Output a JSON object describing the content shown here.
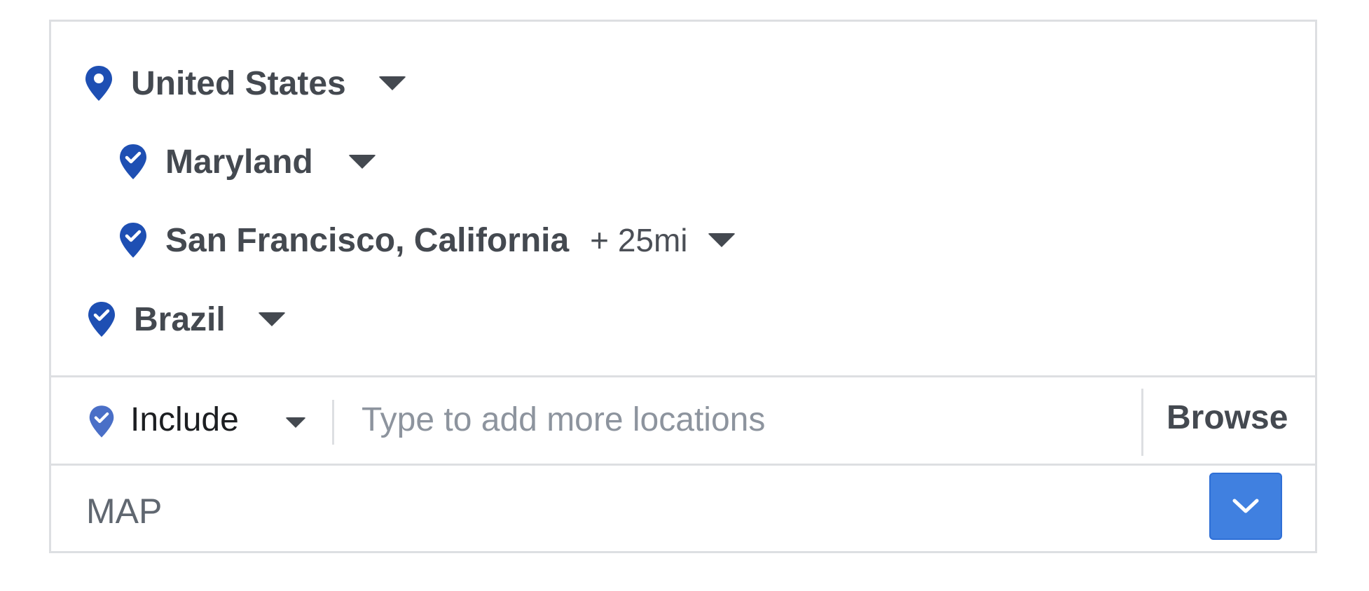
{
  "locations": [
    {
      "name": "United States",
      "icon": "location-pin-icon"
    },
    {
      "name": "Maryland",
      "icon": "location-check-icon"
    },
    {
      "name": "San Francisco, California",
      "radius": "+ 25mi",
      "icon": "location-check-icon"
    },
    {
      "name": "Brazil",
      "icon": "location-check-icon"
    }
  ],
  "input": {
    "mode_label": "Include",
    "placeholder": "Type to add more locations",
    "value": "",
    "browse_label": "Browse"
  },
  "map": {
    "label": "MAP"
  },
  "colors": {
    "pin_blue": "#1e4fb3",
    "accent_blue": "#4080e0",
    "text_dark": "#444950",
    "border": "#dddfe2"
  }
}
